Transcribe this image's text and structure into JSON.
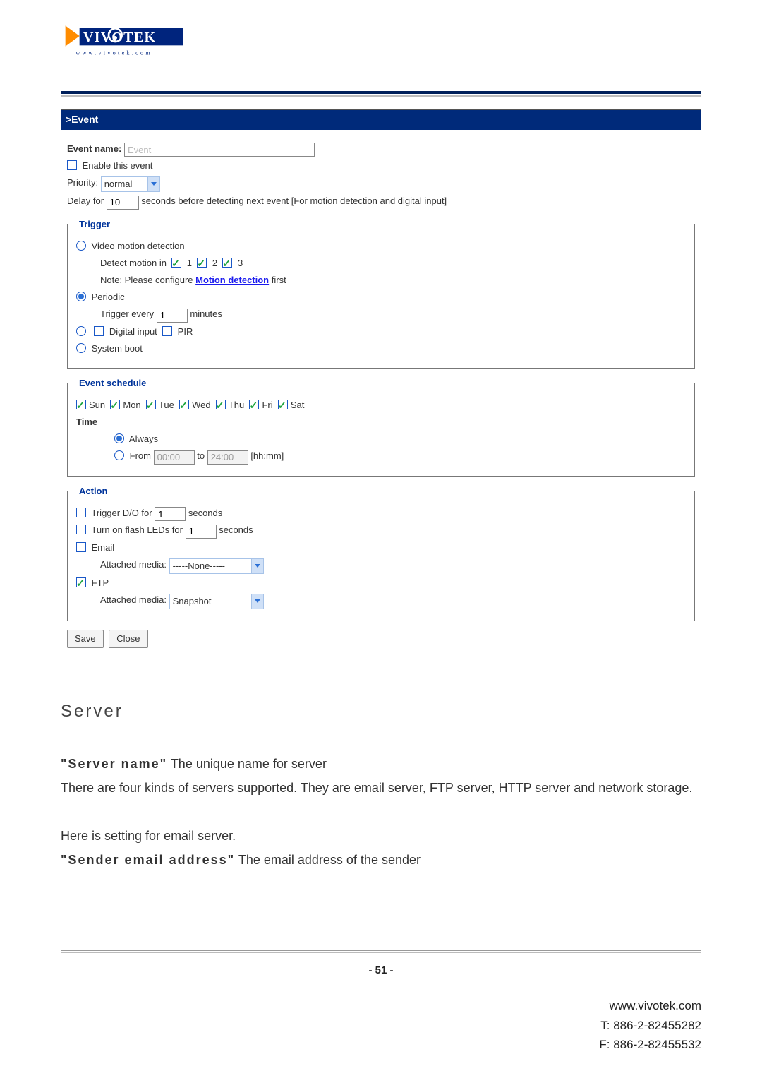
{
  "logo": {
    "top_line": "VIVOTEK",
    "sub": "www.vivotek.com"
  },
  "shot": {
    "header": ">Event",
    "event_name_label": "Event name:",
    "event_name_value": "Event",
    "enable_label": "Enable this event",
    "priority_label": "Priority:",
    "priority_value": "normal",
    "delay_pre": "Delay for",
    "delay_value": "10",
    "delay_post": "seconds before detecting next event [For motion detection and digital input]",
    "trigger": {
      "title": "Trigger",
      "video": "Video motion detection",
      "detect_in": "Detect motion in",
      "m1": "1",
      "m2": "2",
      "m3": "3",
      "note_pre": "Note: Please configure ",
      "note_link": "Motion detection",
      "note_post": " first",
      "periodic": "Periodic",
      "trig_every_pre": "Trigger every",
      "trig_every_val": "1",
      "trig_every_post": "minutes",
      "digital": "Digital input",
      "pir": "PIR",
      "boot": "System boot"
    },
    "schedule": {
      "title": "Event schedule",
      "days": [
        "Sun",
        "Mon",
        "Tue",
        "Wed",
        "Thu",
        "Fri",
        "Sat"
      ],
      "time_label": "Time",
      "always": "Always",
      "from_label": "From",
      "from_val": "00:00",
      "to_label": "to",
      "to_val": "24:00",
      "hhmm": "[hh:mm]"
    },
    "action": {
      "title": "Action",
      "do_pre": "Trigger D/O for",
      "do_val": "1",
      "do_post": "seconds",
      "led_pre": "Turn on flash LEDs for",
      "led_val": "1",
      "led_post": "seconds",
      "email": "Email",
      "attached": "Attached media:",
      "none": "-----None-----",
      "ftp": "FTP",
      "snapshot": "Snapshot"
    },
    "save": "Save",
    "close": "Close"
  },
  "doc": {
    "section": "Server",
    "p1_term": "\"Server name\"",
    "p1_rest": " The unique name for server",
    "p2": "There are four kinds of servers supported. They are email server, FTP server, HTTP server and network storage.",
    "p3": "Here is setting for email server.",
    "p4_term": "\"Sender email address\"",
    "p4_rest": " The email address of the sender"
  },
  "footer": {
    "page": "- 51 -",
    "url": "www.vivotek.com",
    "tel": "T: 886-2-82455282",
    "fax": "F: 886-2-82455532"
  }
}
